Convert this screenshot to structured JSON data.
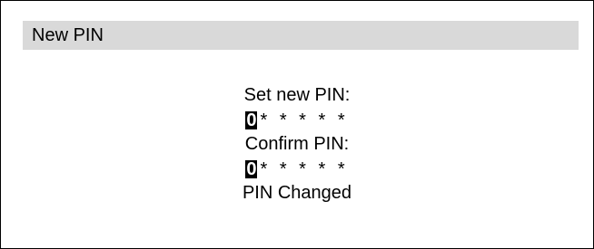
{
  "window": {
    "title": "New PIN"
  },
  "pin_form": {
    "new_pin_label": "Set new PIN:",
    "new_pin_cursor_digit": "0",
    "new_pin_masked": "* * * * *",
    "confirm_pin_label": "Confirm PIN:",
    "confirm_pin_cursor_digit": "0",
    "confirm_pin_masked": "* * * * *",
    "status_message": "PIN Changed"
  },
  "colors": {
    "title_bar_background": "#d9d9d9",
    "cursor_highlight": "#000000",
    "border": "#000000"
  }
}
